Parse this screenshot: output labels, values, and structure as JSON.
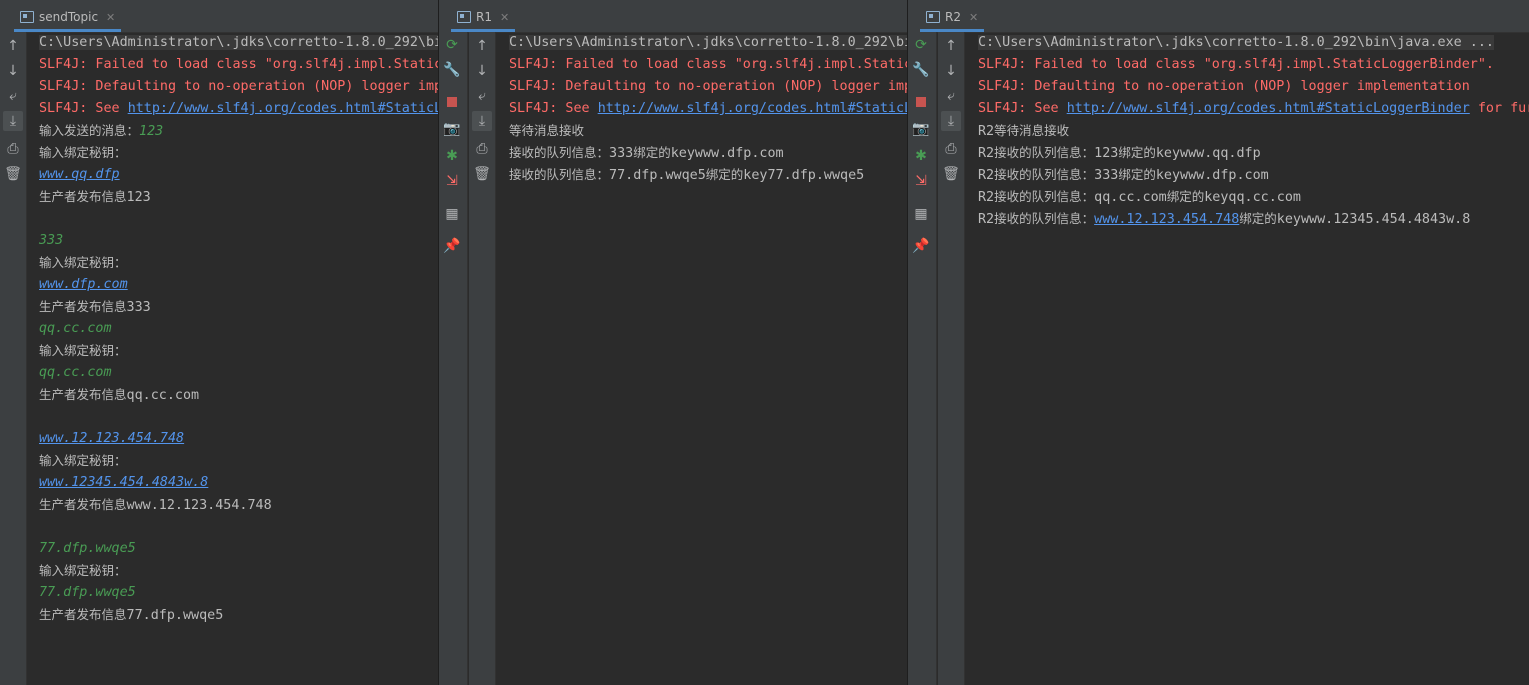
{
  "panels": [
    {
      "tab_label": "sendTopic",
      "tab_close": "✕",
      "lines": [
        {
          "kind": "cmd",
          "parts": [
            {
              "t": "C:\\Users\\Administrator\\.jdks\\corretto-1.8.0_292\\bin",
              "c": "cmd"
            }
          ]
        },
        {
          "parts": [
            {
              "t": "SLF4J: Failed to load class \"org.slf4j.impl.StaticL",
              "c": "red"
            }
          ]
        },
        {
          "parts": [
            {
              "t": "SLF4J: Defaulting to no-operation (NOP) logger impl",
              "c": "red"
            }
          ]
        },
        {
          "parts": [
            {
              "t": "SLF4J: See ",
              "c": "red"
            },
            {
              "t": "http://www.slf4j.org/codes.html#StaticL",
              "c": "link"
            }
          ]
        },
        {
          "parts": [
            {
              "t": "输入发送的消息：",
              "c": "cjk"
            },
            {
              "t": "123",
              "c": "green-i"
            }
          ]
        },
        {
          "parts": [
            {
              "t": "输入绑定秘钥：",
              "c": "cjk"
            }
          ]
        },
        {
          "parts": [
            {
              "t": "www.qq.dfp",
              "c": "link-i"
            }
          ]
        },
        {
          "parts": [
            {
              "t": "生产者发布信息",
              "c": "cjk"
            },
            {
              "t": "123",
              "c": ""
            }
          ]
        },
        {
          "parts": []
        },
        {
          "parts": [
            {
              "t": "333",
              "c": "green-i"
            }
          ]
        },
        {
          "parts": [
            {
              "t": "输入绑定秘钥：",
              "c": "cjk"
            }
          ]
        },
        {
          "parts": [
            {
              "t": "www.dfp.com",
              "c": "link-i"
            }
          ]
        },
        {
          "parts": [
            {
              "t": "生产者发布信息",
              "c": "cjk"
            },
            {
              "t": "333",
              "c": ""
            }
          ]
        },
        {
          "parts": [
            {
              "t": "qq.cc.com",
              "c": "green-i"
            }
          ]
        },
        {
          "parts": [
            {
              "t": "输入绑定秘钥：",
              "c": "cjk"
            }
          ]
        },
        {
          "parts": [
            {
              "t": "qq.cc.com",
              "c": "green-i"
            }
          ]
        },
        {
          "parts": [
            {
              "t": "生产者发布信息",
              "c": "cjk"
            },
            {
              "t": "qq.cc.com",
              "c": ""
            }
          ]
        },
        {
          "parts": []
        },
        {
          "parts": [
            {
              "t": "www.12.123.454.748",
              "c": "link-i"
            }
          ]
        },
        {
          "parts": [
            {
              "t": "输入绑定秘钥：",
              "c": "cjk"
            }
          ]
        },
        {
          "parts": [
            {
              "t": "www.12345.454.4843w.8",
              "c": "link-i"
            }
          ]
        },
        {
          "parts": [
            {
              "t": "生产者发布信息",
              "c": "cjk"
            },
            {
              "t": "www.12.123.454.748",
              "c": ""
            }
          ]
        },
        {
          "parts": []
        },
        {
          "parts": [
            {
              "t": "77.dfp.wwqe5",
              "c": "green-i"
            }
          ]
        },
        {
          "parts": [
            {
              "t": "输入绑定秘钥：",
              "c": "cjk"
            }
          ]
        },
        {
          "parts": [
            {
              "t": "77.dfp.wwqe5",
              "c": "green-i"
            }
          ]
        },
        {
          "parts": [
            {
              "t": "生产者发布信息",
              "c": "cjk"
            },
            {
              "t": "77.dfp.wwqe5",
              "c": ""
            }
          ]
        }
      ]
    },
    {
      "tab_label": "R1",
      "tab_close": "✕",
      "lines": [
        {
          "kind": "cmd",
          "parts": [
            {
              "t": "C:\\Users\\Administrator\\.jdks\\corretto-1.8.0_292\\bi",
              "c": "cmd"
            }
          ]
        },
        {
          "parts": [
            {
              "t": "SLF4J: Failed to load class \"org.slf4j.impl.Static",
              "c": "red"
            }
          ]
        },
        {
          "parts": [
            {
              "t": "SLF4J: Defaulting to no-operation (NOP) logger imp",
              "c": "red"
            }
          ]
        },
        {
          "parts": [
            {
              "t": "SLF4J: See ",
              "c": "red"
            },
            {
              "t": "http://www.slf4j.org/codes.html#StaticL",
              "c": "link"
            }
          ]
        },
        {
          "parts": [
            {
              "t": "等待消息接收",
              "c": "cjk"
            }
          ]
        },
        {
          "parts": [
            {
              "t": "接收的队列信息：",
              "c": "cjk"
            },
            {
              "t": "333",
              "c": ""
            },
            {
              "t": "绑定的",
              "c": "cjk"
            },
            {
              "t": "keywww.dfp.com",
              "c": ""
            }
          ]
        },
        {
          "parts": [
            {
              "t": "接收的队列信息：",
              "c": "cjk"
            },
            {
              "t": "77.dfp.wwqe5",
              "c": ""
            },
            {
              "t": "绑定的",
              "c": "cjk"
            },
            {
              "t": "key77.dfp.wwqe5",
              "c": ""
            }
          ]
        }
      ]
    },
    {
      "tab_label": "R2",
      "tab_close": "✕",
      "lines": [
        {
          "kind": "cmd",
          "parts": [
            {
              "t": "C:\\Users\\Administrator\\.jdks\\corretto-1.8.0_292\\bin\\java.exe ...",
              "c": "cmd"
            }
          ]
        },
        {
          "parts": [
            {
              "t": "SLF4J: Failed to load class \"org.slf4j.impl.StaticLoggerBinder\".",
              "c": "red"
            }
          ]
        },
        {
          "parts": [
            {
              "t": "SLF4J: Defaulting to no-operation (NOP) logger implementation",
              "c": "red"
            }
          ]
        },
        {
          "parts": [
            {
              "t": "SLF4J: See ",
              "c": "red"
            },
            {
              "t": "http://www.slf4j.org/codes.html#StaticLoggerBinder",
              "c": "link"
            },
            {
              "t": " for fur",
              "c": "red"
            }
          ]
        },
        {
          "parts": [
            {
              "t": "R2",
              "c": ""
            },
            {
              "t": "等待消息接收",
              "c": "cjk"
            }
          ]
        },
        {
          "parts": [
            {
              "t": "R2",
              "c": ""
            },
            {
              "t": "接收的队列信息：",
              "c": "cjk"
            },
            {
              "t": "123",
              "c": ""
            },
            {
              "t": "绑定的",
              "c": "cjk"
            },
            {
              "t": "keywww.qq.dfp",
              "c": ""
            }
          ]
        },
        {
          "parts": [
            {
              "t": "R2",
              "c": ""
            },
            {
              "t": "接收的队列信息：",
              "c": "cjk"
            },
            {
              "t": "333",
              "c": ""
            },
            {
              "t": "绑定的",
              "c": "cjk"
            },
            {
              "t": "keywww.dfp.com",
              "c": ""
            }
          ]
        },
        {
          "parts": [
            {
              "t": "R2",
              "c": ""
            },
            {
              "t": "接收的队列信息：",
              "c": "cjk"
            },
            {
              "t": "qq.cc.com",
              "c": ""
            },
            {
              "t": "绑定的",
              "c": "cjk"
            },
            {
              "t": "keyqq.cc.com",
              "c": ""
            }
          ]
        },
        {
          "parts": [
            {
              "t": "R2",
              "c": ""
            },
            {
              "t": "接收的队列信息：",
              "c": "cjk"
            },
            {
              "t": "www.12.123.454.748",
              "c": "link"
            },
            {
              "t": "绑定的",
              "c": "cjk"
            },
            {
              "t": "keywww.12345.454.4843w.8",
              "c": ""
            }
          ]
        }
      ]
    }
  ],
  "toolbar_icons": {
    "left": [
      "up-arrow-icon",
      "down-arrow-icon",
      "soft-wrap-icon",
      "scroll-to-end-icon",
      "print-icon",
      "trash-icon"
    ],
    "side": [
      "rerun-icon",
      "wrench-icon",
      "stop-icon",
      "camera-icon",
      "debug-bug-icon",
      "exit-icon",
      "layout-icon",
      "pin-icon"
    ]
  },
  "colors": {
    "background": "#2b2b2b",
    "toolbar": "#3c3f41",
    "error": "#ff6b68",
    "input": "#499c54",
    "link": "#5394ec",
    "text": "#bbbbbb"
  }
}
